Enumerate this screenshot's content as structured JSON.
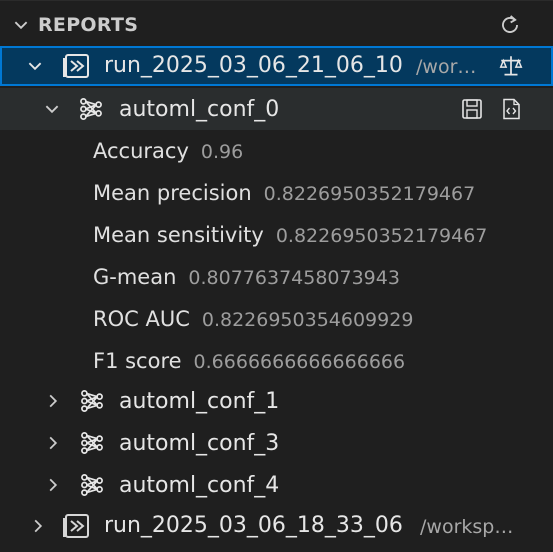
{
  "panel": {
    "title": "REPORTS"
  },
  "runs": [
    {
      "name": "run_2025_03_06_21_06_10",
      "path": "/wor…",
      "expanded": true,
      "configs": [
        {
          "name": "automl_conf_0",
          "expanded": true,
          "metrics": [
            {
              "label": "Accuracy",
              "value": "0.96"
            },
            {
              "label": "Mean precision",
              "value": "0.8226950352179467"
            },
            {
              "label": "Mean sensitivity",
              "value": "0.8226950352179467"
            },
            {
              "label": "G-mean",
              "value": "0.8077637458073943"
            },
            {
              "label": "ROC AUC",
              "value": "0.8226950354609929"
            },
            {
              "label": "F1 score",
              "value": "0.6666666666666666"
            }
          ]
        },
        {
          "name": "automl_conf_1",
          "expanded": false
        },
        {
          "name": "automl_conf_3",
          "expanded": false
        },
        {
          "name": "automl_conf_4",
          "expanded": false
        }
      ]
    },
    {
      "name": "run_2025_03_06_18_33_06",
      "path": "/worksp…",
      "expanded": false
    }
  ],
  "icons": {
    "refresh": "refresh-icon",
    "report": "report-icon",
    "network": "network-icon",
    "save": "save-icon",
    "code": "code-file-icon",
    "compare": "scale-icon"
  },
  "colors": {
    "background": "#1f1f1f",
    "selection": "#04395e",
    "focus_border": "#0078d4",
    "hover": "#2a2d2e",
    "muted_text": "#9d9d9d"
  }
}
